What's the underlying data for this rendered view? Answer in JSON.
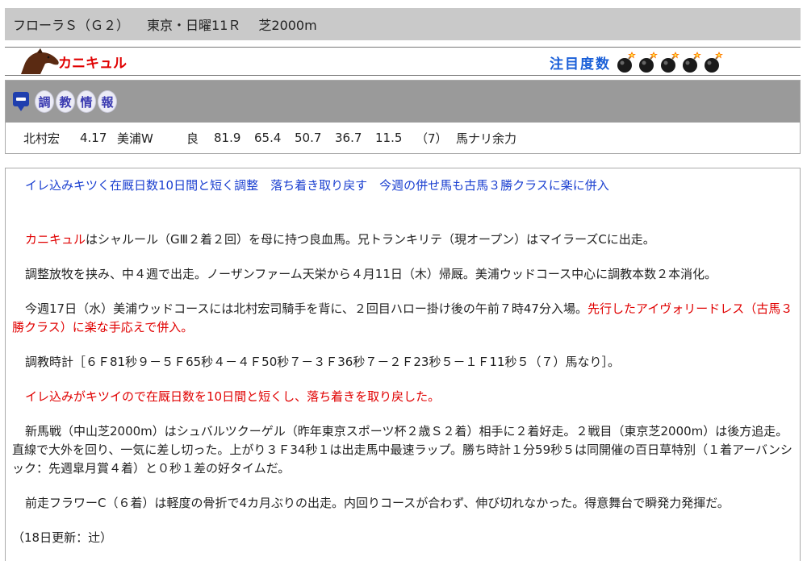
{
  "race": {
    "name": "フローラＳ（Ｇ２）",
    "venue": "東京・日曜11Ｒ",
    "course": "芝2000m"
  },
  "horse": {
    "name": "カニキュル",
    "attention_label": "注目度数",
    "attention_count": 5
  },
  "training": {
    "title_chars": [
      "調",
      "教",
      "情",
      "報"
    ],
    "row": {
      "jockey": "北村宏",
      "date": "4.17",
      "course": "美浦W",
      "condition": "良",
      "t1": "81.9",
      "t2": "65.4",
      "t3": "50.7",
      "t4": "36.7",
      "t5": "11.5",
      "position": "（7）",
      "note": "馬ナリ余力"
    }
  },
  "comment": {
    "lead": "イレ込みキツく在厩日数10日間と短く調整　落ち着き取り戻す　今週の併せ馬も古馬３勝クラスに楽に併入",
    "p1_name": "カニキュル",
    "p1_rest": "はシャルール（GⅢ２着２回）を母に持つ良血馬。兄トランキリテ（現オープン）はマイラーズCに出走。",
    "p2": "調整放牧を挟み、中４週で出走。ノーザンファーム天栄から４月11日（木）帰厩。美浦ウッドコース中心に調教本数２本消化。",
    "p3_plain": "今週17日（水）美浦ウッドコースには北村宏司騎手を背に、２回目ハロー掛け後の午前７時47分入場。",
    "p3_red": "先行したアイヴォリードレス（古馬３勝クラス）に楽な手応えで併入。",
    "p4": "調教時計［６Ｆ81秒９－５Ｆ65秒４－４Ｆ50秒７－３Ｆ36秒７－２Ｆ23秒５－１Ｆ11秒５（７）馬なり］。",
    "p5_red": "イレ込みがキツイので在厩日数を10日間と短くし、落ち着きを取り戻した。",
    "p6": "新馬戦（中山芝2000m）はシュバルツクーゲル（昨年東京スポーツ杯２歳Ｓ２着）相手に２着好走。２戦目（東京芝2000m）は後方追走。直線で大外を回り、一気に差し切った。上がり３Ｆ34秒１は出走馬中最速ラップ。勝ち時計１分59秒５は同開催の百日草特別（１着アーバンシック：先週皐月賞４着）と０秒１差の好タイムだ。",
    "p7": "前走フラワーC（６着）は軽度の骨折で4カ月ぶりの出走。内回りコースが合わず、伸び切れなかった。得意舞台で瞬発力発揮だ。",
    "update": "（18日更新：辻）"
  }
}
